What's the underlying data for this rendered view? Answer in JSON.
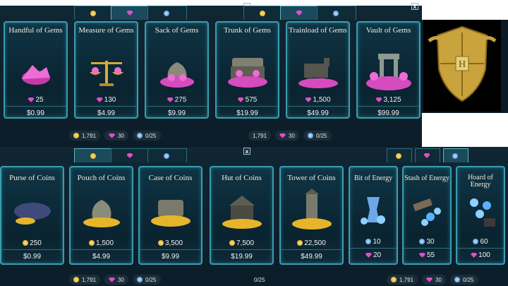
{
  "gems_panel": {
    "tabs": [
      {
        "icon": "coin-icon"
      },
      {
        "icon": "gem-icon"
      },
      {
        "icon": "energy-icon"
      }
    ],
    "cards": [
      {
        "title": "Handful of Gems",
        "amount": "25",
        "price": "$0.99"
      },
      {
        "title": "Measure of Gems",
        "amount": "130",
        "price": "$4.99"
      },
      {
        "title": "Sack of Gems",
        "amount": "275",
        "price": "$9.99"
      },
      {
        "title": "Trunk of Gems",
        "amount": "575",
        "price": "$19.99"
      },
      {
        "title": "Trainload of Gems",
        "amount": "1,500",
        "price": "$49.99"
      },
      {
        "title": "Vault of Gems",
        "amount": "3,125",
        "price": "$99.99"
      }
    ],
    "footer": {
      "coins": "1,791",
      "gems": "30",
      "energy": "0/25"
    },
    "footer_right": {
      "coins": "1,791",
      "gems": "30",
      "energy": "0/25"
    }
  },
  "coins_panel": {
    "cards": [
      {
        "title": "Purse of Coins",
        "amount": "250",
        "price": "$0.99"
      },
      {
        "title": "Pouch of Coins",
        "amount": "1,500",
        "price": "$4.99"
      },
      {
        "title": "Case of Coins",
        "amount": "3,500",
        "price": "$9.99"
      },
      {
        "title": "Hut of Coins",
        "amount": "7,500",
        "price": "$19.99"
      },
      {
        "title": "Tower of Coins",
        "amount": "22,500",
        "price": "$49.99"
      }
    ],
    "footer": {
      "coins": "1,791",
      "gems": "30",
      "energy": "0/25"
    },
    "footer_right": {
      "energy": "0/25"
    }
  },
  "energy_panel": {
    "cards": [
      {
        "title": "Bit of Energy",
        "amount": "10",
        "price": "20"
      },
      {
        "title": "Stash of Energy",
        "amount": "30",
        "price": "55"
      },
      {
        "title": "Hoard of Energy",
        "amount": "60",
        "price": "100"
      }
    ],
    "footer": {
      "coins": "1,791",
      "gems": "30",
      "energy": "0/25"
    }
  },
  "close_label": "x"
}
